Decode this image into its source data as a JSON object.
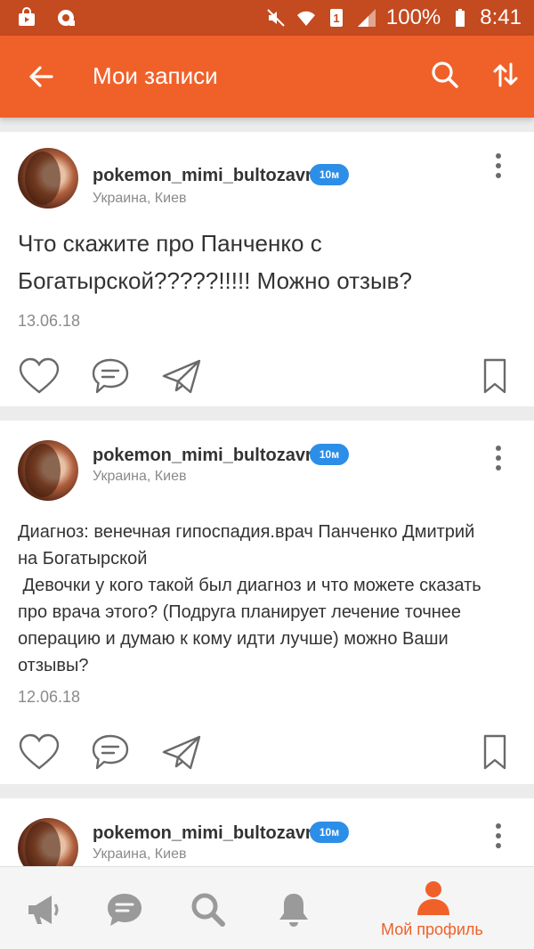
{
  "status_bar": {
    "battery": "100%",
    "time": "8:41"
  },
  "header": {
    "title": "Мои записи"
  },
  "posts": [
    {
      "username": "pokemon_mimi_bultozavr",
      "badge": "10м",
      "location": "Украина, Киев",
      "text_lines": [
        "Что скажите про Панченко с",
        "Богатырской?????!!!!! Можно отзыв?"
      ],
      "date": "13.06.18"
    },
    {
      "username": "pokemon_mimi_bultozavr",
      "badge": "10м",
      "location": "Украина, Киев",
      "text_lines": [
        "Диагноз: венечная гипоспадия.врач Панченко Дмитрий",
        "на Богатырской",
        " Девочки у кого такой был диагноз и что можете сказать",
        "про врача этого? (Подруга планирует лечение точнее",
        "операцию и думаю к кому идти лучше) можно Ваши",
        "отзывы?"
      ],
      "date": "12.06.18"
    },
    {
      "username": "pokemon_mimi_bultozavr",
      "badge": "10м",
      "location": "Украина, Киев"
    }
  ],
  "bottom_nav": {
    "items": [
      {
        "icon": "megaphone-icon"
      },
      {
        "icon": "chat-icon"
      },
      {
        "icon": "search-icon"
      },
      {
        "icon": "bell-icon"
      },
      {
        "icon": "profile-icon",
        "label": "Мой профиль",
        "active": true
      }
    ]
  },
  "colors": {
    "accent": "#f0612a",
    "status_bar": "#c44a20",
    "badge": "#2d8ee8"
  }
}
